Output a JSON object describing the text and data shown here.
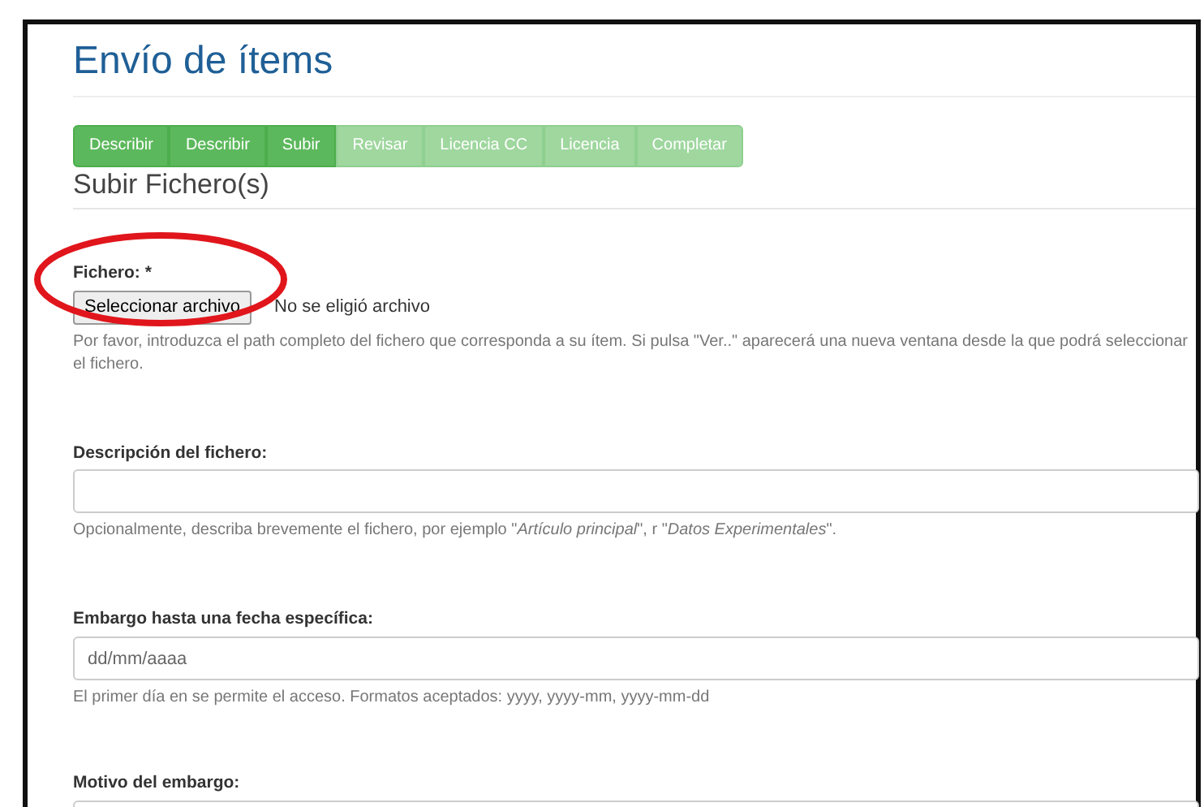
{
  "title": "Envío de ítems",
  "steps": [
    {
      "label": "Describir",
      "completed": true
    },
    {
      "label": "Describir",
      "completed": true
    },
    {
      "label": "Subir",
      "completed": true
    },
    {
      "label": "Revisar",
      "completed": false
    },
    {
      "label": "Licencia CC",
      "completed": false
    },
    {
      "label": "Licencia",
      "completed": false
    },
    {
      "label": "Completar",
      "completed": false
    }
  ],
  "section_title": "Subir Fichero(s)",
  "file_field": {
    "label": "Fichero: *",
    "button": "Seleccionar archivo",
    "status": "No se eligió archivo",
    "help": "Por favor, introduzca el path completo del fichero que corresponda a su ítem. Si pulsa \"Ver..\" aparecerá una nueva ventana desde la que podrá seleccionar el fichero.",
    "highlighted": true
  },
  "fields": [
    {
      "label": "Descripción del fichero:",
      "help": "Opcionalmente, describa brevemente el fichero, por ejemplo \"*Artículo principal*\", r \"*Datos Experimentales*\"."
    },
    {
      "label": "Embargo hasta una fecha específica:",
      "placeholder": "dd/mm/aaaa",
      "help": "El primer día en se permite el acceso. Formatos aceptados: yyyy, yyyy-mm, yyyy-mm-dd"
    },
    {
      "label": "Motivo del embargo:"
    }
  ]
}
